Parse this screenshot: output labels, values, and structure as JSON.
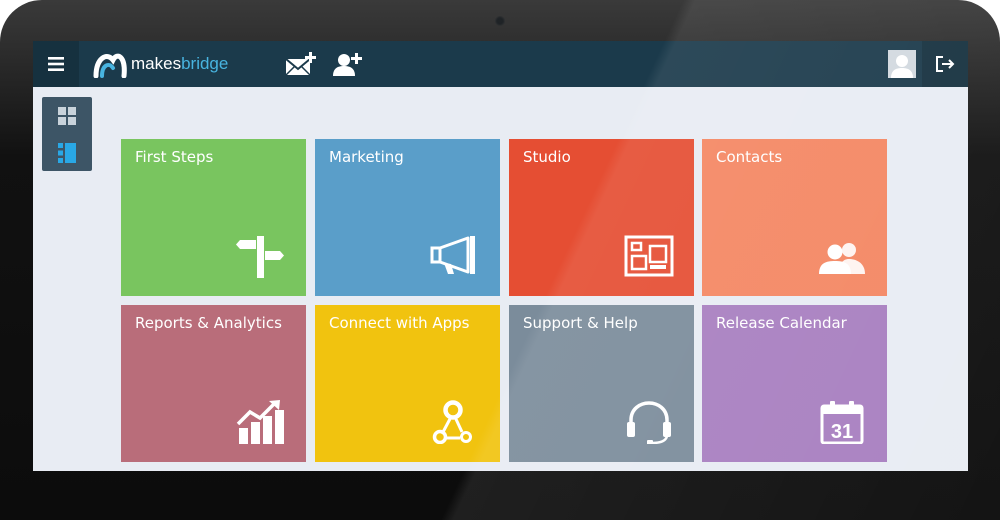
{
  "app": {
    "logo_prefix": "makes",
    "logo_suffix": "bridge"
  },
  "colors": {
    "topbar": "#1b3a4b",
    "screen_bg": "#e8ecf3",
    "accent": "#48b4e0"
  },
  "header": {
    "menu_icon": "hamburger-icon",
    "compose_icon": "envelope-add-icon",
    "add_user_icon": "user-add-icon",
    "avatar_icon": "avatar",
    "logout_icon": "logout-icon"
  },
  "sidebar": {
    "items": [
      {
        "icon": "grid-view-icon",
        "active": false
      },
      {
        "icon": "list-view-icon",
        "active": true
      }
    ]
  },
  "tiles": [
    {
      "label": "First Steps",
      "color": "#79c55f",
      "icon": "signpost-icon"
    },
    {
      "label": "Marketing",
      "color": "#5a9ec9",
      "icon": "megaphone-icon"
    },
    {
      "label": "Studio",
      "color": "#e54e33",
      "icon": "layout-icon"
    },
    {
      "label": "Contacts",
      "color": "#f48763",
      "icon": "contacts-icon"
    },
    {
      "label": "Reports & Analytics",
      "color": "#b96d7a",
      "icon": "chart-icon"
    },
    {
      "label": "Connect with Apps",
      "color": "#f1c30f",
      "icon": "connect-icon"
    },
    {
      "label": "Support & Help",
      "color": "#7b8c9b",
      "icon": "headset-icon"
    },
    {
      "label": "Release Calendar",
      "color": "#a87fc0",
      "icon": "calendar-icon",
      "calendar_day": "31"
    }
  ]
}
